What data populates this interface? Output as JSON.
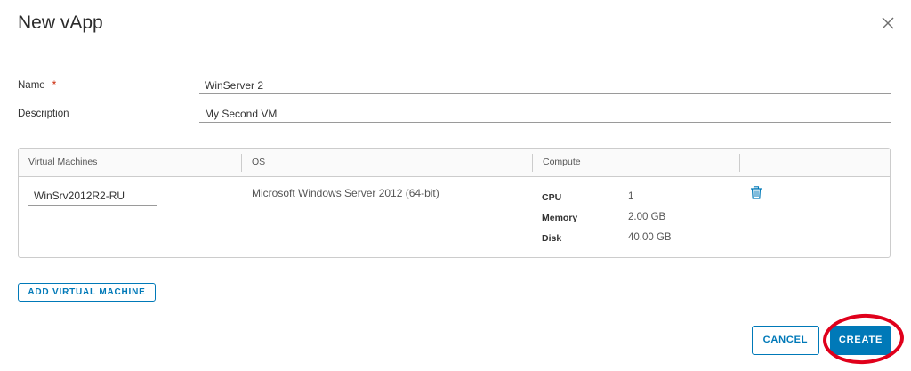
{
  "dialog": {
    "title": "New vApp",
    "close_icon": "close-icon"
  },
  "form": {
    "name_label": "Name",
    "name_required_marker": "*",
    "name_value": "WinServer 2",
    "description_label": "Description",
    "description_value": "My Second VM"
  },
  "vm_table": {
    "columns": [
      "Virtual Machines",
      "OS",
      "Compute",
      ""
    ],
    "rows": [
      {
        "vm_name": "WinSrv2012R2-RU",
        "os": "Microsoft Windows Server 2012 (64-bit)",
        "compute": [
          {
            "key": "CPU",
            "value": "1"
          },
          {
            "key": "Memory",
            "value": "2.00 GB"
          },
          {
            "key": "Disk",
            "value": "40.00 GB"
          }
        ],
        "action_icon": "trash-icon"
      }
    ]
  },
  "buttons": {
    "add_vm": "ADD VIRTUAL MACHINE",
    "cancel": "CANCEL",
    "create": "CREATE"
  },
  "colors": {
    "accent": "#0079b8",
    "required": "#c92100",
    "annotation_ring": "#e0001b"
  }
}
